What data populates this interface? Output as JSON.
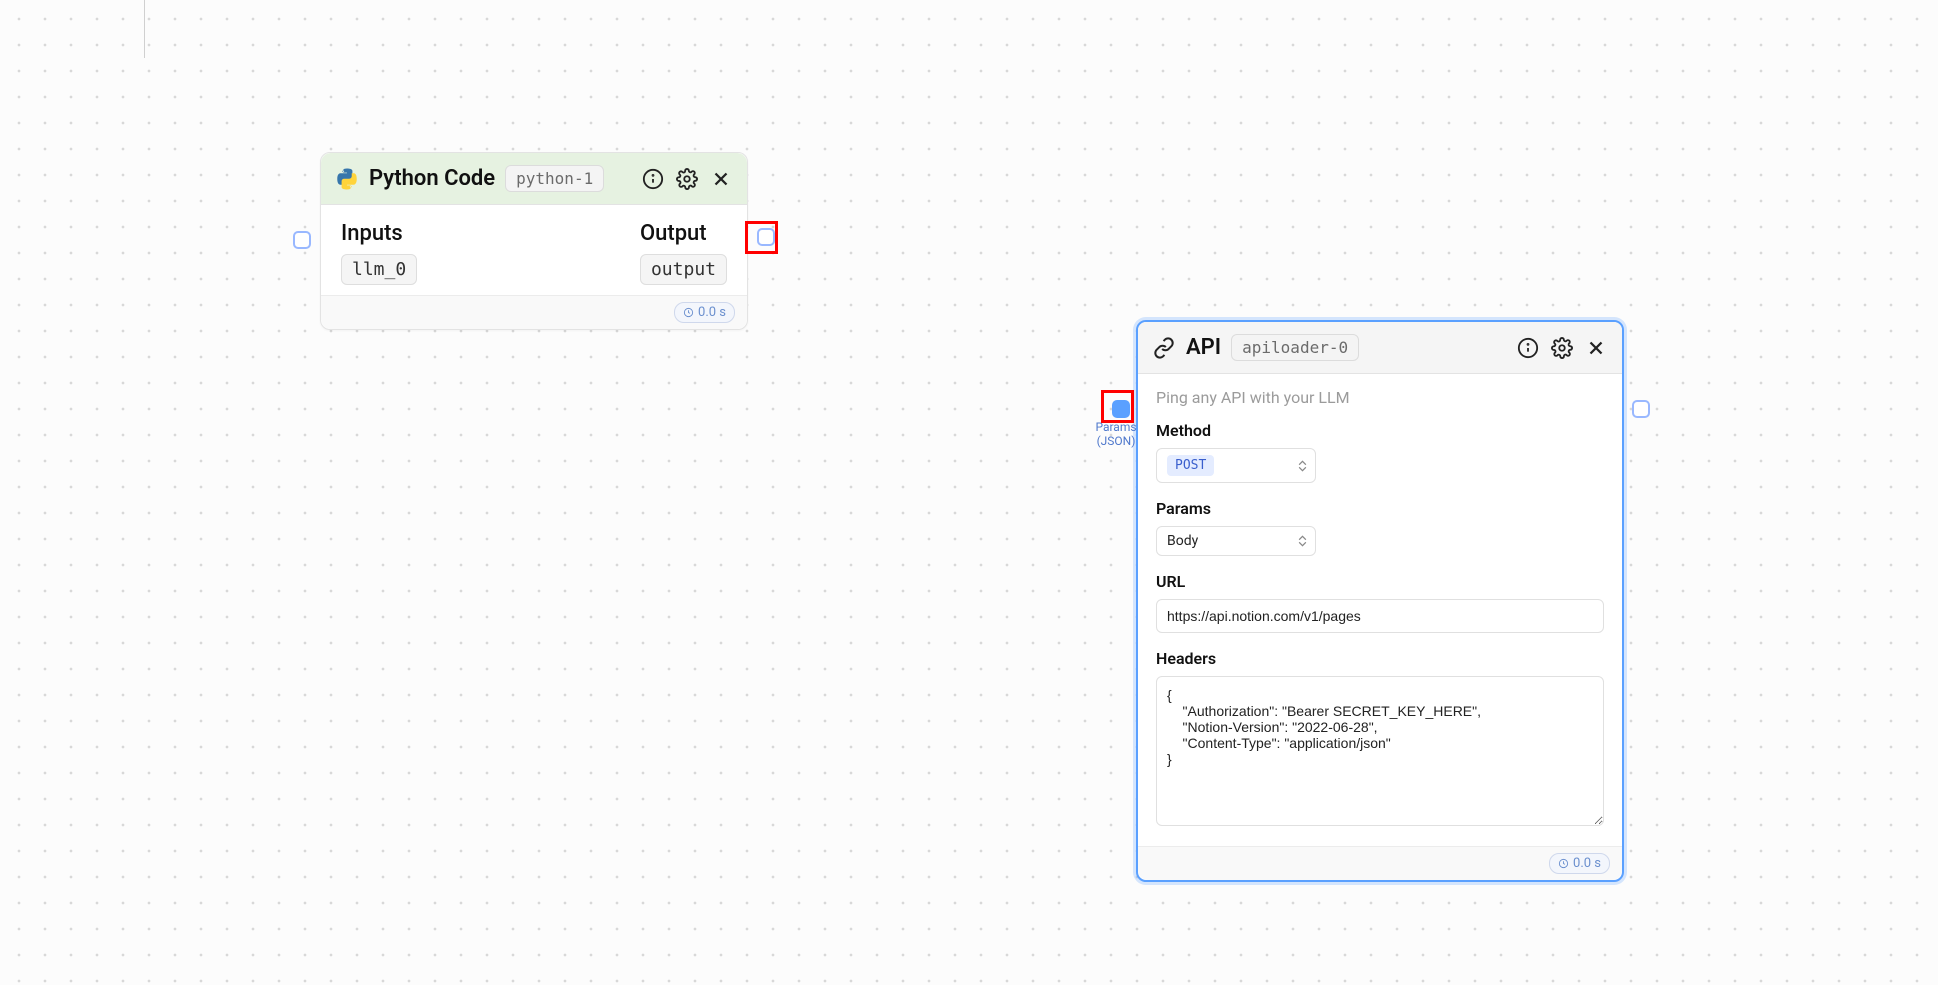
{
  "python_node": {
    "title": "Python Code",
    "id": "python-1",
    "inputs_label": "Inputs",
    "output_label": "Output",
    "input_chip": "llm_0",
    "output_chip": "output",
    "time": "0.0 s"
  },
  "api_node": {
    "title": "API",
    "id": "apiloader-0",
    "subtitle": "Ping any API with your LLM",
    "method_label": "Method",
    "method_value": "POST",
    "params_label": "Params",
    "params_value": "Body",
    "url_label": "URL",
    "url_value": "https://api.notion.com/v1/pages",
    "headers_label": "Headers",
    "headers_value": "{\n    \"Authorization\": \"Bearer SECRET_KEY_HERE\",\n    \"Notion-Version\": \"2022-06-28\",\n    \"Content-Type\": \"application/json\"\n}",
    "time": "0.0 s",
    "port_label_top": "Params",
    "port_label_bottom": "(JSON)"
  }
}
